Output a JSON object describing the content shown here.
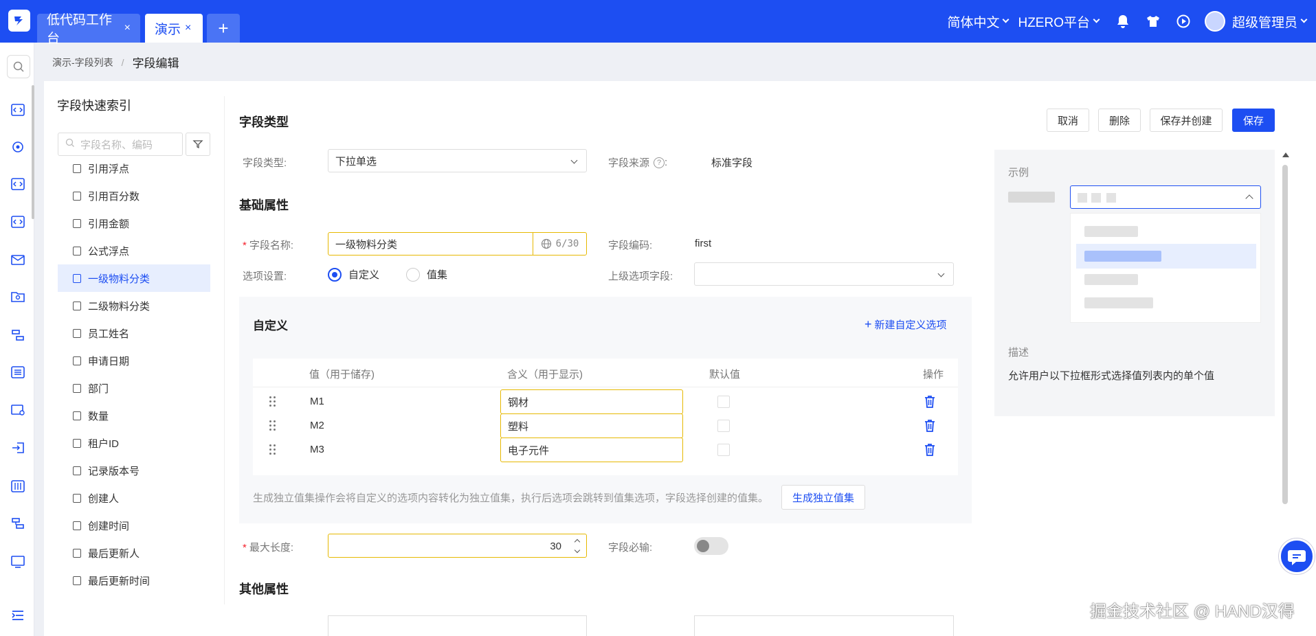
{
  "topbar": {
    "tabs": [
      {
        "label": "低代码工作台",
        "close": "×"
      },
      {
        "label": "演示",
        "close": "×"
      }
    ],
    "add_tab": "+",
    "language": "简体中文",
    "platform": "HZERO平台",
    "user": "超级管理员",
    "accent": "#1d4ef2"
  },
  "breadcrumb": {
    "parent": "演示-字段列表",
    "separator": "/",
    "current": "字段编辑"
  },
  "index_panel": {
    "title": "字段快速索引",
    "search_placeholder": "字段名称、编码",
    "items": [
      {
        "label": "引用浮点",
        "active": false
      },
      {
        "label": "引用百分数",
        "active": false
      },
      {
        "label": "引用金额",
        "active": false
      },
      {
        "label": "公式浮点",
        "active": false
      },
      {
        "label": "一级物料分类",
        "active": true
      },
      {
        "label": "二级物料分类",
        "active": false
      },
      {
        "label": "员工姓名",
        "active": false
      },
      {
        "label": "申请日期",
        "active": false
      },
      {
        "label": "部门",
        "active": false
      },
      {
        "label": "数量",
        "active": false
      },
      {
        "label": "租户ID",
        "active": false
      },
      {
        "label": "记录版本号",
        "active": false
      },
      {
        "label": "创建人",
        "active": false
      },
      {
        "label": "创建时间",
        "active": false
      },
      {
        "label": "最后更新人",
        "active": false
      },
      {
        "label": "最后更新时间",
        "active": false
      }
    ]
  },
  "actions": {
    "cancel": "取消",
    "delete": "删除",
    "save_create": "保存并创建",
    "save": "保存"
  },
  "field_type": {
    "section": "字段类型",
    "type_label": "字段类型:",
    "type_value": "下拉单选",
    "source_label": "字段来源",
    "source_suffix": ":",
    "source_value": "标准字段"
  },
  "basic": {
    "section": "基础属性",
    "name_label": "字段名称:",
    "name_value": "一级物料分类",
    "name_count": "6/30",
    "code_label": "字段编码:",
    "code_value": "first",
    "option_label": "选项设置:",
    "option_custom": "自定义",
    "option_valueset": "值集",
    "parent_label": "上级选项字段:"
  },
  "custom": {
    "title": "自定义",
    "new_option": "新建自定义选项",
    "columns": {
      "value": "值（用于储存)",
      "meaning": "含义（用于显示)",
      "default": "默认值",
      "action": "操作"
    },
    "rows": [
      {
        "value": "M1",
        "meaning": "钢材"
      },
      {
        "value": "M2",
        "meaning": "塑料"
      },
      {
        "value": "M3",
        "meaning": "电子元件"
      }
    ],
    "note": "生成独立值集操作会将自定义的选项内容转化为独立值集，执行后选项会跳转到值集选项，字段选择创建的值集。",
    "gen_button": "生成独立值集"
  },
  "max_length": {
    "label": "最大长度:",
    "value": "30"
  },
  "required": {
    "label": "字段必输:"
  },
  "other": {
    "section": "其他属性"
  },
  "example": {
    "title": "示例",
    "desc_label": "描述",
    "desc": "允许用户以下拉框形式选择值列表内的单个值"
  },
  "watermark": "掘金技术社区 @ HAND汉得"
}
